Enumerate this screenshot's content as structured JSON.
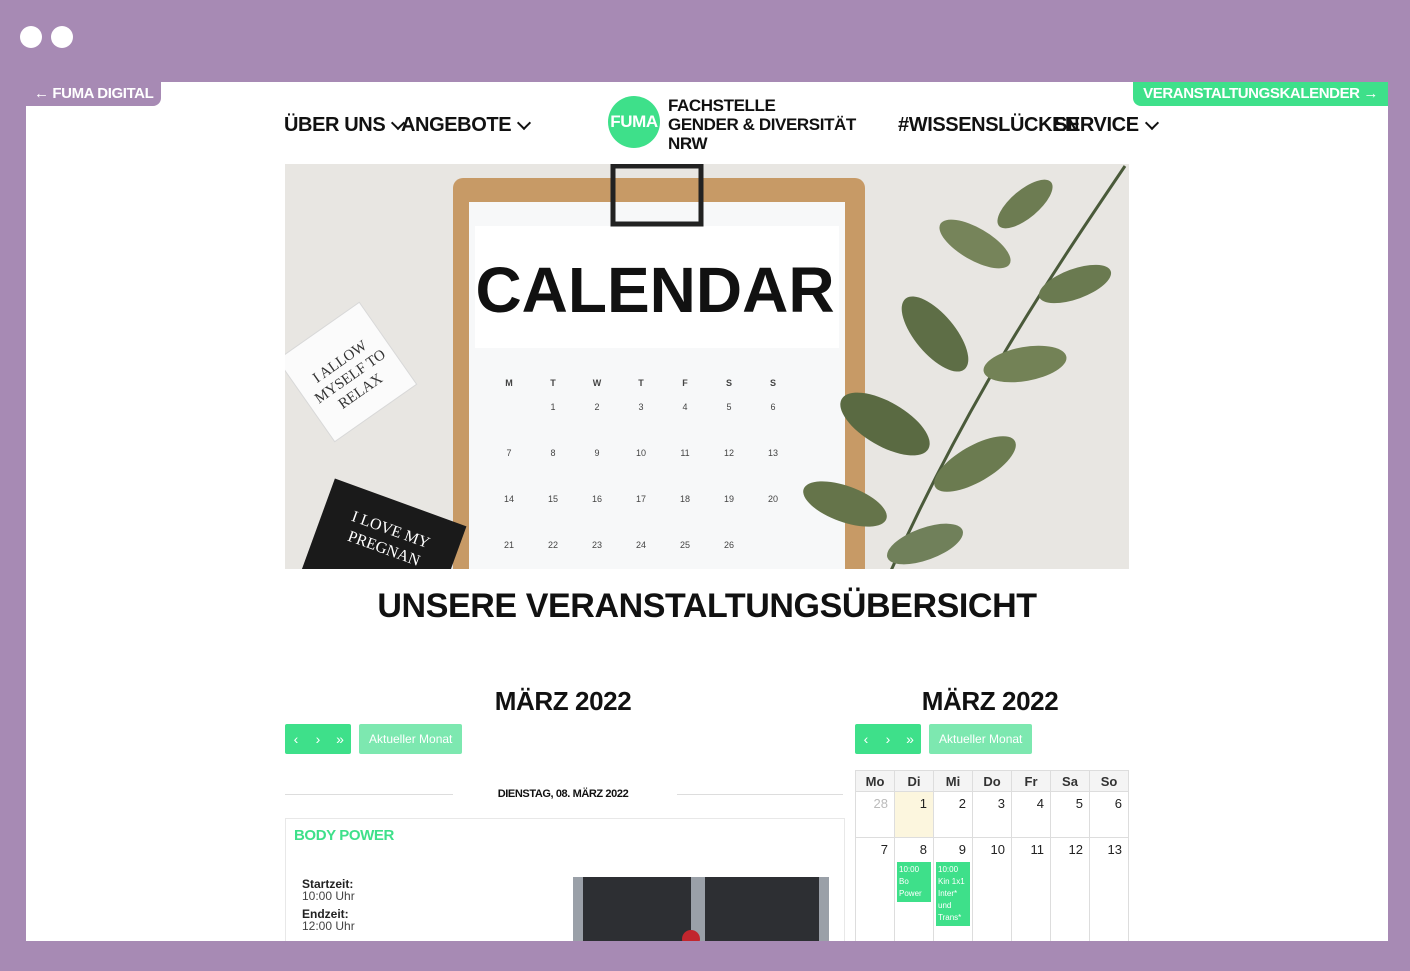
{
  "top_tabs": {
    "left": "← FUMA DIGITAL",
    "right": "VERANSTALTUNGSKALENDER →"
  },
  "nav": {
    "items": [
      "ÜBER UNS",
      "ANGEBOTE",
      "#WISSENSLÜCKEN",
      "SERVICE"
    ]
  },
  "logo": {
    "mark": "FUMA",
    "line1": "FACHSTELLE",
    "line2": "GENDER & DIVERSITÄT",
    "line3": "NRW"
  },
  "hero": {
    "calendar_word": "CALENDAR",
    "weekdays": [
      "M",
      "T",
      "W",
      "T",
      "F",
      "S",
      "S"
    ],
    "rows": [
      [
        "",
        "1",
        "2",
        "3",
        "4",
        "5",
        "6"
      ],
      [
        "7",
        "8",
        "9",
        "10",
        "11",
        "12",
        "13"
      ],
      [
        "14",
        "15",
        "16",
        "17",
        "18",
        "19",
        "20"
      ],
      [
        "21",
        "22",
        "23",
        "24",
        "25",
        "26",
        ""
      ]
    ],
    "card1": [
      "I ALLOW",
      "MYSELF TO",
      "RELAX"
    ],
    "card2": [
      "I LOVE MY",
      "PREGNAN"
    ]
  },
  "overview_title": "UNSERE VERANSTALTUNGSÜBERSICHT",
  "list_calendar": {
    "title": "MÄRZ 2022",
    "nav_prev": "‹",
    "nav_next": "›",
    "nav_last": "»",
    "current_month": "Aktueller Monat",
    "day_label": "DIENSTAG, 08. MÄRZ 2022",
    "event": {
      "title": "BODY POWER",
      "start_label": "Startzeit:",
      "start_value": "10:00 Uhr",
      "end_label": "Endzeit:",
      "end_value": "12:00 Uhr"
    }
  },
  "grid_calendar": {
    "title": "MÄRZ 2022",
    "current_month": "Aktueller Monat",
    "weekdays": [
      "Mo",
      "Di",
      "Mi",
      "Do",
      "Fr",
      "Sa",
      "So"
    ],
    "week1": [
      "28",
      "1",
      "2",
      "3",
      "4",
      "5",
      "6"
    ],
    "week2": [
      "7",
      "8",
      "9",
      "10",
      "11",
      "12",
      "13"
    ],
    "event_di": "10:00 Bo Power",
    "event_mi": "10:00 Kin 1x1 Inter* und Trans*"
  },
  "colors": {
    "frame": "#a78ab4",
    "accent": "#3ee08a"
  }
}
